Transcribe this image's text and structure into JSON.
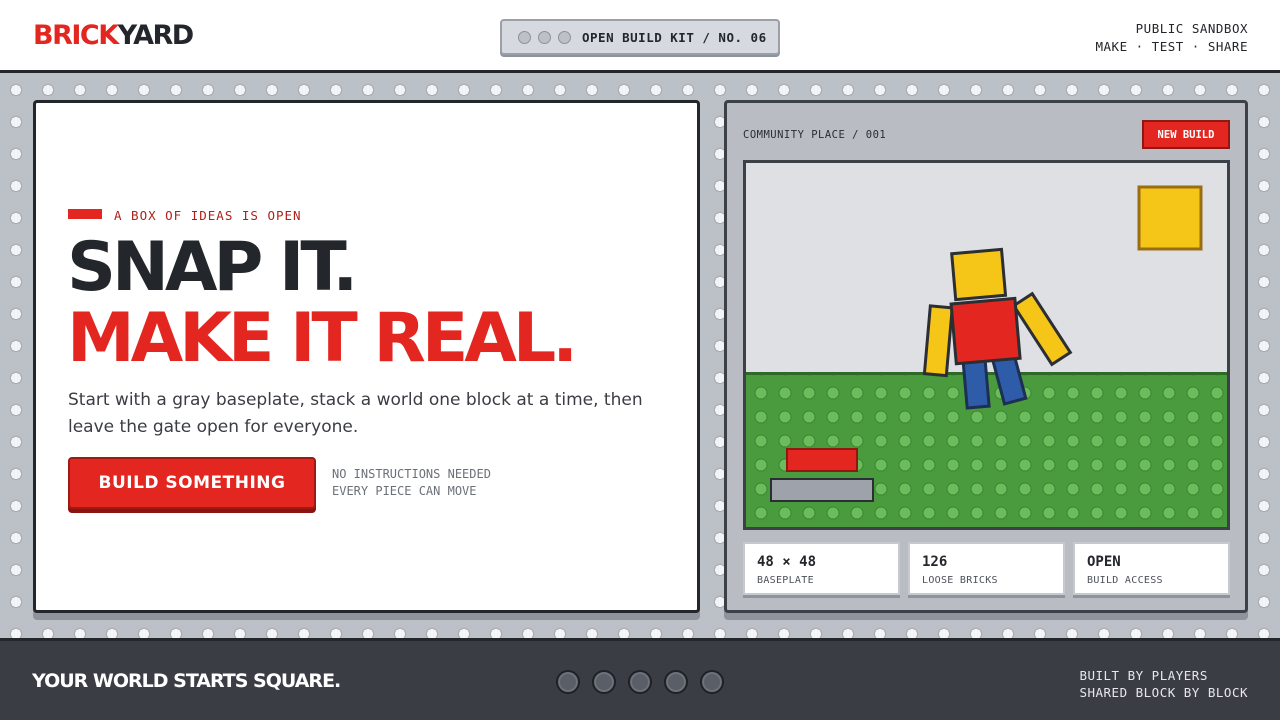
{
  "header": {
    "logo": {
      "part1": "BRICK",
      "part2": "YARD"
    },
    "kit_label": "OPEN BUILD KIT / NO. 06",
    "right_line1": "PUBLIC SANDBOX",
    "right_line2": "MAKE · TEST · SHARE"
  },
  "hero": {
    "eyebrow": "A BOX OF IDEAS IS OPEN",
    "headline_1": "SNAP IT.",
    "headline_2": "MAKE IT REAL.",
    "lead": "Start with a gray baseplate, stack a world one block at a time, then leave the gate open for everyone.",
    "cta_label": "BUILD SOMETHING",
    "note_1": "NO INSTRUCTIONS NEEDED",
    "note_2": "EVERY PIECE CAN MOVE"
  },
  "panel": {
    "place_label": "COMMUNITY PLACE / 001",
    "new_build_label": "NEW BUILD",
    "stats": [
      {
        "value": "48 × 48",
        "label": "BASEPLATE"
      },
      {
        "value": "126",
        "label": "LOOSE BRICKS"
      },
      {
        "value": "OPEN",
        "label": "BUILD ACCESS"
      }
    ]
  },
  "footer": {
    "tagline": "YOUR WORLD STARTS SQUARE.",
    "right_line1": "BUILT BY PLAYERS",
    "right_line2": "SHARED BLOCK BY BLOCK"
  },
  "colors": {
    "brand_red": "#e32620",
    "ink": "#23262b",
    "baseplate_green": "#4a9b3d",
    "figure_yellow": "#f5c518",
    "figure_blue": "#2f5ca8"
  },
  "icons": [
    "window-dot-icon",
    "stud-icon"
  ]
}
